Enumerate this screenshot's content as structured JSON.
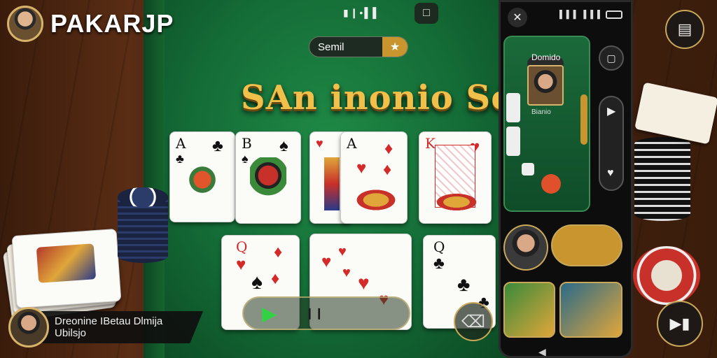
{
  "header": {
    "brand": "PAKARJP",
    "status_icons": "▮❙•▌▌",
    "top_button_icon": "□"
  },
  "mode_pill": {
    "label": "Semil",
    "icon": "★"
  },
  "game_title": "SAn inonio Séra",
  "cards_top": [
    {
      "rank": "A",
      "suit": "♣",
      "color": "black"
    },
    {
      "rank": "B",
      "suit": "♠",
      "color": "black"
    },
    {
      "rank": "",
      "suit": "♥",
      "color": "red"
    },
    {
      "rank": "A",
      "suit": "♦",
      "color": "red"
    },
    {
      "rank": "K",
      "suit": "♥",
      "color": "red"
    }
  ],
  "cards_bottom": [
    {
      "rank": "Q",
      "suit": "♦",
      "color": "red"
    },
    {
      "rank": "",
      "suit": "♥",
      "color": "red"
    },
    {
      "rank": "Q",
      "suit": "♣",
      "color": "black"
    }
  ],
  "playbar": {
    "play_icon": "▶",
    "bars_icon": "❙❙"
  },
  "toast": {
    "line1": "Dreonine IBetau Dlmija",
    "line2": "Ubilsjo"
  },
  "phone": {
    "board_label": "Domido",
    "player_name": "Bianio",
    "close_icon": "✕",
    "signal": "▌▌▌ ▌▌▌"
  },
  "colors": {
    "felt": "#146b36",
    "gold": "#c9a85a",
    "title": "#f0c04a"
  }
}
